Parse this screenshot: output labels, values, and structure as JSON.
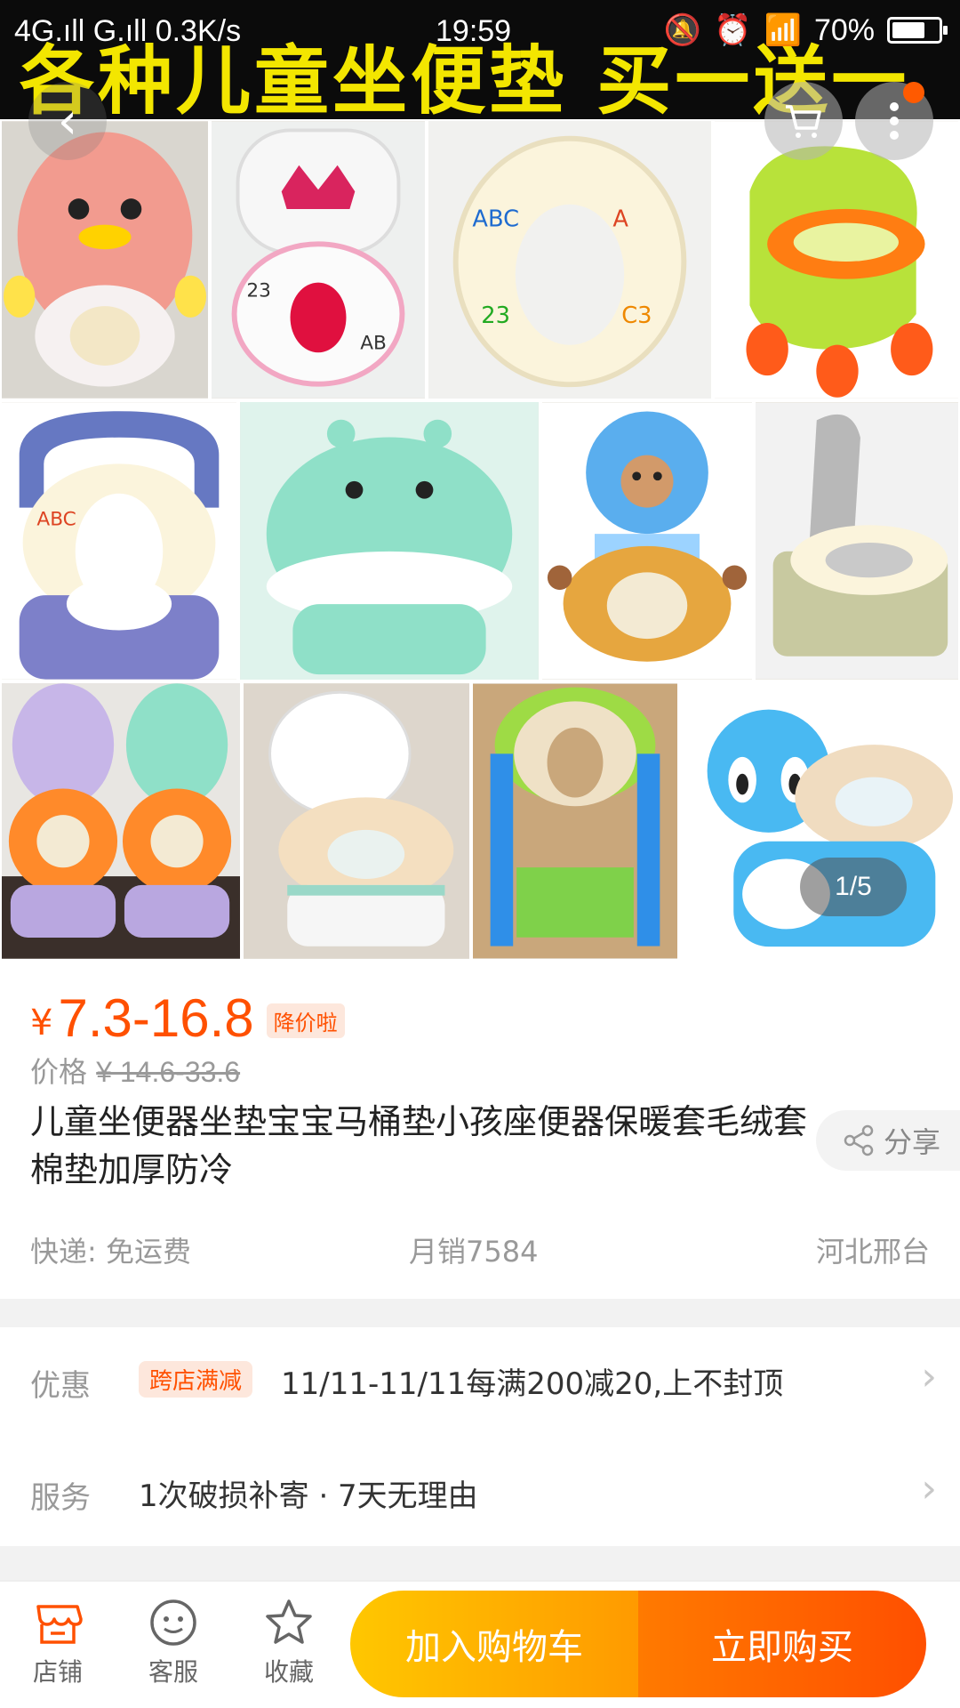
{
  "status_bar": {
    "left": "4G.ıll G.ıll 0.3K/s",
    "time": "19:59",
    "battery": "70%"
  },
  "banner": {
    "text": "各种儿童坐便垫 买一送一"
  },
  "gallery": {
    "pager": "1/5"
  },
  "product": {
    "currency": "¥",
    "price": "7.3-16.8",
    "price_tag": "降价啦",
    "original_label": "价格",
    "original_price": "¥ 14.6-33.6",
    "title": "儿童坐便器坐垫宝宝马桶垫小孩座便器保暖套毛绒套棉垫加厚防冷",
    "share": "分享",
    "shipping": "快递: 免运费",
    "monthly_sales": "月销7584",
    "location": "河北邢台"
  },
  "promo": {
    "label": "优惠",
    "badge": "跨店满减",
    "text": "11/11-11/11每满200减20,上不封顶"
  },
  "service": {
    "label": "服务",
    "text": "1次破损补寄 · 7天无理由"
  },
  "bottom": {
    "shop": "店铺",
    "service": "客服",
    "favorite": "收藏",
    "add_to_cart": "加入购物车",
    "buy_now": "立即购买"
  },
  "colors": {
    "accent": "#ff5000",
    "cart_gradient": [
      "#ffc700",
      "#ff9a00"
    ],
    "buy_gradient": [
      "#ff7a00",
      "#ff4f00"
    ]
  }
}
